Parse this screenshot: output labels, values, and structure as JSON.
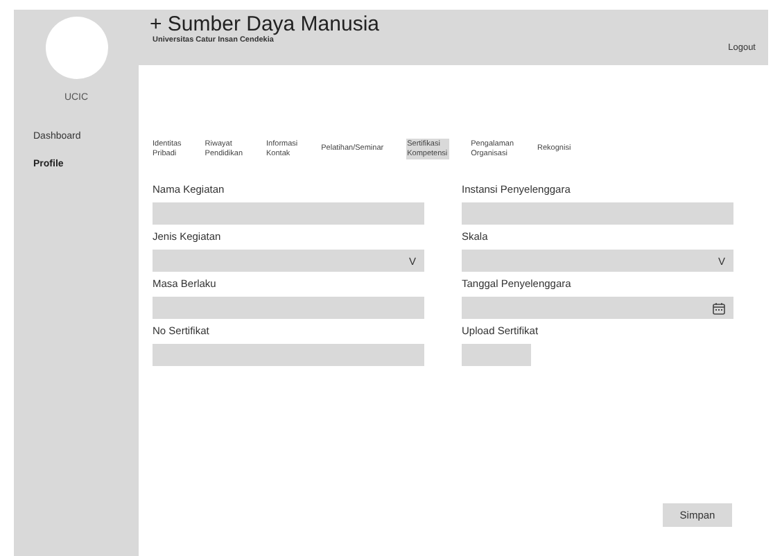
{
  "sidebar": {
    "org": "UCIC",
    "items": [
      {
        "label": "Dashboard",
        "selected": false
      },
      {
        "label": "Profile",
        "selected": true
      }
    ]
  },
  "header": {
    "title": "+ Sumber Daya Manusia",
    "subtitle": "Universitas Catur Insan Cendekia",
    "logout": "Logout"
  },
  "tabs": [
    {
      "lines": [
        "Identitas",
        "Pribadi"
      ],
      "selected": false
    },
    {
      "lines": [
        "Riwayat",
        "Pendidikan"
      ],
      "selected": false
    },
    {
      "lines": [
        "Informasi",
        "Kontak"
      ],
      "selected": false
    },
    {
      "lines": [
        "Pelatihan/Seminar"
      ],
      "selected": false
    },
    {
      "lines": [
        "Sertifikasi",
        "Kompetensi"
      ],
      "selected": true
    },
    {
      "lines": [
        "Pengalaman",
        "Organisasi"
      ],
      "selected": false
    },
    {
      "lines": [
        "Rekognisi"
      ],
      "selected": false
    }
  ],
  "form": {
    "left": [
      {
        "label": "Nama Kegiatan",
        "kind": "text"
      },
      {
        "label": "Jenis Kegiatan",
        "kind": "select",
        "caret": "V"
      },
      {
        "label": "Masa Berlaku",
        "kind": "text"
      },
      {
        "label": "No Sertifikat",
        "kind": "text"
      }
    ],
    "right": [
      {
        "label": "Instansi Penyelenggara",
        "kind": "text"
      },
      {
        "label": "Skala",
        "kind": "select",
        "caret": "V"
      },
      {
        "label": "Tanggal Penyelenggara",
        "kind": "date"
      },
      {
        "label": "Upload Sertifikat",
        "kind": "file"
      }
    ]
  },
  "save": "Simpan"
}
